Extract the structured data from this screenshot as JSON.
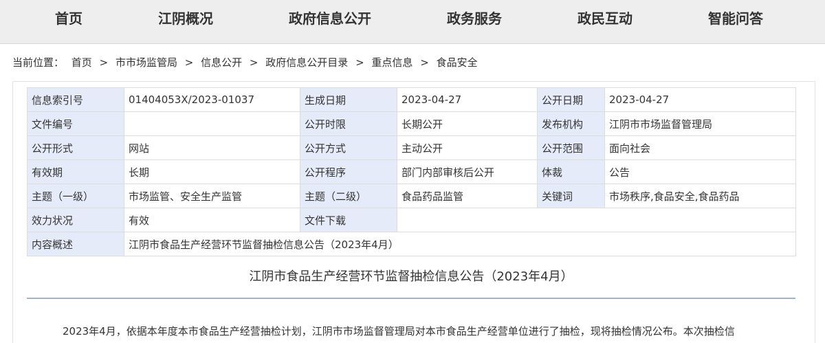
{
  "nav": {
    "items": [
      "首页",
      "江阴概况",
      "政府信息公开",
      "政务服务",
      "政民互动",
      "智能问答"
    ]
  },
  "breadcrumb": {
    "prefix": "当前位置：",
    "items": [
      "首页",
      "市市场监管局",
      "信息公开",
      "政府信息公开目录",
      "重点信息",
      "食品安全"
    ],
    "separator": ">"
  },
  "meta": {
    "index_no_label": "信息索引号",
    "index_no_value": "01404053X/2023-01037",
    "created_label": "生成日期",
    "created_value": "2023-04-27",
    "published_label": "公开日期",
    "published_value": "2023-04-27",
    "doc_no_label": "文件编号",
    "doc_no_value": "",
    "period_label": "公开时限",
    "period_value": "长期公开",
    "issuer_label": "发布机构",
    "issuer_value": "江阴市市场监督管理局",
    "form_label": "公开形式",
    "form_value": "网站",
    "method_label": "公开方式",
    "method_value": "主动公开",
    "scope_label": "公开范围",
    "scope_value": "面向社会",
    "validity_label": "有效期",
    "validity_value": "长期",
    "procedure_label": "公开程序",
    "procedure_value": "部门内部审核后公开",
    "genre_label": "体裁",
    "genre_value": "公告",
    "topic1_label": "主题（一级）",
    "topic1_value": "市场监管、安全生产监管",
    "topic2_label": "主题（二级）",
    "topic2_value": "食品药品监管",
    "keywords_label": "关键词",
    "keywords_value": "市场秩序,食品安全,食品药品",
    "status_label": "效力状况",
    "status_value": "有效",
    "download_label": "文件下载",
    "summary_label": "内容概述",
    "summary_value": "江阴市食品生产经营环节监督抽检信息公告（2023年4月）"
  },
  "article": {
    "title": "江阴市食品生产经营环节监督抽检信息公告（2023年4月）",
    "body": "2023年4月，依据本年度本市食品生产经营抽检计划，江阴市市场监督管理局对本市食品生产经营单位进行了抽检，现将抽检情况公布。本次抽检信"
  },
  "colors": {
    "nav_bg": "#eeeeee",
    "label_cell_bg": "#e6ebfa",
    "rule": "#9fb1d6"
  }
}
